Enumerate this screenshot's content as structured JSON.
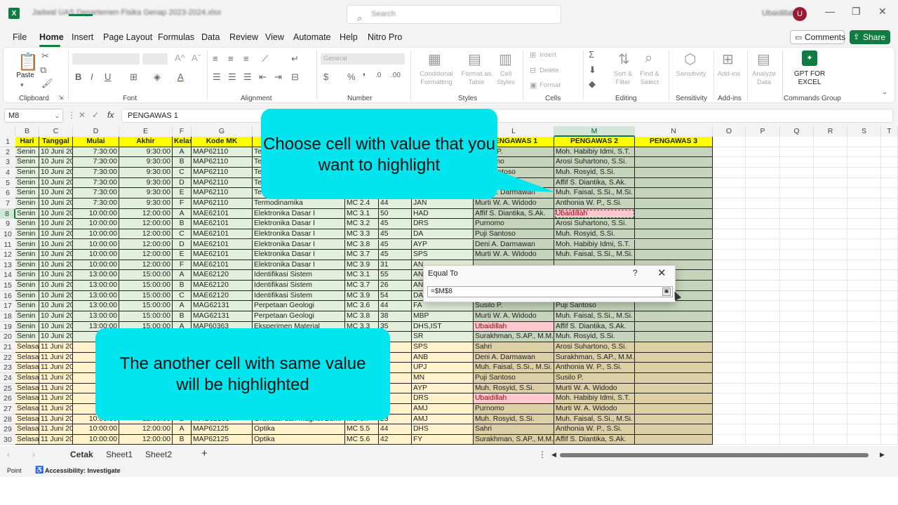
{
  "titlebar": {
    "app_icon": "X",
    "doc_title": "Jadwal UAS Departemen Fisika Genap 2023-2024.xlsx",
    "search_placeholder": "Search",
    "user_name": "Ubaidillah",
    "avatar_initial": "U",
    "minimize": "—",
    "restore": "❐",
    "close": "✕"
  },
  "menu": {
    "items": [
      "File",
      "Home",
      "Insert",
      "Page Layout",
      "Formulas",
      "Data",
      "Review",
      "View",
      "Automate",
      "Help",
      "Nitro Pro"
    ],
    "active": "Home",
    "comments_label": "Comments",
    "share_label": "Share"
  },
  "ribbon": {
    "groups": [
      "Clipboard",
      "Font",
      "Alignment",
      "Number",
      "Styles",
      "Cells",
      "Editing",
      "Sensitivity",
      "Add-ins",
      "Commands Group"
    ],
    "paste_label": "Paste",
    "number_format": "General",
    "styles_buttons": [
      "Conditional Formatting",
      "Format as Table",
      "Cell Styles"
    ],
    "cells_buttons": [
      "Insert",
      "Delete",
      "Format"
    ],
    "editing_buttons": [
      "Sort & Filter",
      "Find & Select"
    ],
    "sensitivity_label": "Sensitivity",
    "addins_label": "Add-ins",
    "analyze_label": "Analyze Data",
    "gpt_label": "GPT FOR EXCEL"
  },
  "formula_bar": {
    "name_box": "M8",
    "cancel_symbol": "✕",
    "enter_symbol": "✓",
    "fx_symbol": "fx",
    "content": "PENGAWAS 1"
  },
  "columns": [
    "B",
    "C",
    "D",
    "E",
    "F",
    "G",
    "H",
    "I",
    "J",
    "K",
    "L",
    "M",
    "N",
    "O",
    "P",
    "Q",
    "R",
    "S",
    "T"
  ],
  "selected_column": "M",
  "selected_row": "8",
  "headers": [
    "Hari",
    "Tanggal",
    "Mulai",
    "Akhir",
    "Kelas",
    "Kode MK",
    "",
    "",
    "",
    "",
    "PENGAWAS 1",
    "PENGAWAS 2",
    "PENGAWAS 3"
  ],
  "rows": [
    {
      "n": "2",
      "day": "Senin",
      "date": "10 Juni 2024",
      "start": "7:30:00",
      "end": "9:30:00",
      "cls": "A",
      "code": "MAP62110",
      "course": "Te",
      "room": "",
      "cap": "",
      "lec": "",
      "p1": "Susilo P.",
      "p2": "Moh. Habibiy Idmi, S.T.",
      "p1_hl": false,
      "p2_hl": false
    },
    {
      "n": "3",
      "day": "Senin",
      "date": "10 Juni 2024",
      "start": "7:30:00",
      "end": "9:30:00",
      "cls": "B",
      "code": "MAP62110",
      "course": "Te",
      "room": "",
      "cap": "",
      "lec": "",
      "p1": "Purnomo",
      "p2": "Arosi Suhartono, S.Si.",
      "p1_hl": false,
      "p2_hl": false
    },
    {
      "n": "4",
      "day": "Senin",
      "date": "10 Juni 2024",
      "start": "7:30:00",
      "end": "9:30:00",
      "cls": "C",
      "code": "MAP62110",
      "course": "Te",
      "room": "",
      "cap": "",
      "lec": "",
      "p1": "Puji Santoso",
      "p2": "Muh. Rosyid, S.Si.",
      "p1_hl": false,
      "p2_hl": false
    },
    {
      "n": "5",
      "day": "Senin",
      "date": "10 Juni 2024",
      "start": "7:30:00",
      "end": "9:30:00",
      "cls": "D",
      "code": "MAP62110",
      "course": "Te",
      "room": "",
      "cap": "",
      "lec": "",
      "p1": "",
      "p2": "Affif S. Diantika, S.Ak.",
      "p1_hl": false,
      "p2_hl": false
    },
    {
      "n": "6",
      "day": "Senin",
      "date": "10 Juni 2024",
      "start": "7:30:00",
      "end": "9:30:00",
      "cls": "E",
      "code": "MAP62110",
      "course": "Te",
      "room": "",
      "cap": "",
      "lec": "",
      "p1": "Deni A. Darmawan",
      "p2": "Muh. Faisal, S.Si., M.Si.",
      "p1_hl": false,
      "p2_hl": false
    },
    {
      "n": "7",
      "day": "Senin",
      "date": "10 Juni 2024",
      "start": "7:30:00",
      "end": "9:30:00",
      "cls": "F",
      "code": "MAP62110",
      "course": "Termodinamika",
      "room": "MC 2.4",
      "cap": "44",
      "lec": "JAN",
      "p1": "Murti W. A. Widodo",
      "p2": "Anthonia W. P., S.Si.",
      "p1_hl": false,
      "p2_hl": false
    },
    {
      "n": "8",
      "day": "Senin",
      "date": "10 Juni 2024",
      "start": "10:00:00",
      "end": "12:00:00",
      "cls": "A",
      "code": "MAE62101",
      "course": "Elektronika Dasar I",
      "room": "MC 3.1",
      "cap": "50",
      "lec": "HAD",
      "p1": "Affif S. Diantika, S.Ak.",
      "p2": "Ubaidillah",
      "p1_hl": false,
      "p2_hl": true
    },
    {
      "n": "9",
      "day": "Senin",
      "date": "10 Juni 2024",
      "start": "10:00:00",
      "end": "12:00:00",
      "cls": "B",
      "code": "MAE62101",
      "course": "Elektronika Dasar I",
      "room": "MC 3.2",
      "cap": "45",
      "lec": "DRS",
      "p1": "Purnomo",
      "p2": "Arosi Suhartono, S.Si.",
      "p1_hl": false,
      "p2_hl": false
    },
    {
      "n": "10",
      "day": "Senin",
      "date": "10 Juni 2024",
      "start": "10:00:00",
      "end": "12:00:00",
      "cls": "C",
      "code": "MAE62101",
      "course": "Elektronika Dasar I",
      "room": "MC 3.3",
      "cap": "45",
      "lec": "DA",
      "p1": "Puji Santoso",
      "p2": "Muh. Rosyid, S.Si.",
      "p1_hl": false,
      "p2_hl": false
    },
    {
      "n": "11",
      "day": "Senin",
      "date": "10 Juni 2024",
      "start": "10:00:00",
      "end": "12:00:00",
      "cls": "D",
      "code": "MAE62101",
      "course": "Elektronika Dasar I",
      "room": "MC 3.8",
      "cap": "45",
      "lec": "AYP",
      "p1": "Deni A. Darmawan",
      "p2": "Moh. Habibiy Idmi, S.T.",
      "p1_hl": false,
      "p2_hl": false
    },
    {
      "n": "12",
      "day": "Senin",
      "date": "10 Juni 2024",
      "start": "10:00:00",
      "end": "12:00:00",
      "cls": "E",
      "code": "MAE62101",
      "course": "Elektronika Dasar I",
      "room": "MC 3.7",
      "cap": "45",
      "lec": "SPS",
      "p1": "Murti W. A. Widodo",
      "p2": "Muh. Faisal, S.Si., M.Si.",
      "p1_hl": false,
      "p2_hl": false
    },
    {
      "n": "13",
      "day": "Senin",
      "date": "10 Juni 2024",
      "start": "10:00:00",
      "end": "12:00:00",
      "cls": "F",
      "code": "MAE62101",
      "course": "Elektronika Dasar I",
      "room": "MC 3.9",
      "cap": "31",
      "lec": "AN",
      "p1": "",
      "p2": "",
      "p1_hl": false,
      "p2_hl": false
    },
    {
      "n": "14",
      "day": "Senin",
      "date": "10 Juni 2024",
      "start": "13:00:00",
      "end": "15:00:00",
      "cls": "A",
      "code": "MAE62120",
      "course": "Identifikasi Sistem",
      "room": "MC 3.1",
      "cap": "55",
      "lec": "AN",
      "p1": "",
      "p2": "",
      "p1_hl": false,
      "p2_hl": false
    },
    {
      "n": "15",
      "day": "Senin",
      "date": "10 Juni 2024",
      "start": "13:00:00",
      "end": "15:00:00",
      "cls": "B",
      "code": "MAE62120",
      "course": "Identifikasi Sistem",
      "room": "MC 3.7",
      "cap": "26",
      "lec": "AN",
      "p1": "",
      "p2": "",
      "p1_hl": false,
      "p2_hl": false
    },
    {
      "n": "16",
      "day": "Senin",
      "date": "10 Juni 2024",
      "start": "13:00:00",
      "end": "15:00:00",
      "cls": "C",
      "code": "MAE62120",
      "course": "Identifikasi Sistem",
      "room": "MC 3.9",
      "cap": "54",
      "lec": "DA",
      "p1": "",
      "p2": "",
      "p1_hl": false,
      "p2_hl": false
    },
    {
      "n": "17",
      "day": "Senin",
      "date": "10 Juni 2024",
      "start": "13:00:00",
      "end": "15:00:00",
      "cls": "A",
      "code": "MAG62131",
      "course": "Perpetaan Geologi",
      "room": "MC 3.6",
      "cap": "44",
      "lec": "FA",
      "p1": "Susilo P.",
      "p2": "Puji Santoso",
      "p1_hl": false,
      "p2_hl": false
    },
    {
      "n": "18",
      "day": "Senin",
      "date": "10 Juni 2024",
      "start": "13:00:00",
      "end": "15:00:00",
      "cls": "B",
      "code": "MAG62131",
      "course": "Perpetaan Geologi",
      "room": "MC 3.8",
      "cap": "38",
      "lec": "MBP",
      "p1": "Murti W. A. Widodo",
      "p2": "Muh. Faisal, S.Si., M.Si.",
      "p1_hl": false,
      "p2_hl": false
    },
    {
      "n": "19",
      "day": "Senin",
      "date": "10 Juni 2024",
      "start": "13:00:00",
      "end": "15:00:00",
      "cls": "A",
      "code": "MAP60363",
      "course": "Eksperimen Material",
      "room": "MC 3.3",
      "cap": "35",
      "lec": "DHS,IST",
      "p1": "Ubaidillah",
      "p2": "Affif S. Diantika, S.Ak.",
      "p1_hl": true,
      "p2_hl": false
    },
    {
      "n": "20",
      "day": "Senin",
      "date": "10 Juni 2024",
      "start": "",
      "end": "",
      "cls": "",
      "code": "",
      "course": "",
      "room": "",
      "cap": "24",
      "lec": "SR",
      "p1": "Surakhman, S.AP., M.M.",
      "p2": "Muh. Rosyid, S.Si.",
      "p1_hl": false,
      "p2_hl": false
    },
    {
      "n": "21",
      "day": "Selasa",
      "date": "11 Juni 2024",
      "start": "",
      "end": "",
      "cls": "",
      "code": "",
      "course": "",
      "room": "",
      "cap": "37",
      "lec": "SPS",
      "p1": "Sahri",
      "p2": "Arosi Suhartono, S.Si.",
      "p1_hl": false,
      "p2_hl": false
    },
    {
      "n": "22",
      "day": "Selasa",
      "date": "11 Juni 2024",
      "start": "",
      "end": "",
      "cls": "",
      "code": "",
      "course": "",
      "room": "",
      "cap": "46",
      "lec": "ANB",
      "p1": "Deni A. Darmawan",
      "p2": "Surakhman, S.AP., M.M.",
      "p1_hl": false,
      "p2_hl": false
    },
    {
      "n": "23",
      "day": "Selasa",
      "date": "11 Juni 2024",
      "start": "",
      "end": "",
      "cls": "",
      "code": "",
      "course": "",
      "room": "",
      "cap": "45",
      "lec": "UPJ",
      "p1": "Muh. Faisal, S.Si., M.Si.",
      "p2": "Anthonia W. P., S.Si.",
      "p1_hl": false,
      "p2_hl": false
    },
    {
      "n": "24",
      "day": "Selasa",
      "date": "11 Juni 2024",
      "start": "",
      "end": "",
      "cls": "",
      "code": "",
      "course": "",
      "room": "",
      "cap": "45",
      "lec": "MN",
      "p1": "Puji Santoso",
      "p2": "Susilo P.",
      "p1_hl": false,
      "p2_hl": false
    },
    {
      "n": "25",
      "day": "Selasa",
      "date": "11 Juni 2024",
      "start": "",
      "end": "",
      "cls": "",
      "code": "",
      "course": "",
      "room": "",
      "cap": "44",
      "lec": "AYP",
      "p1": "Muh. Rosyid, S.Si.",
      "p2": "Murti W. A. Widodo",
      "p1_hl": false,
      "p2_hl": false
    },
    {
      "n": "26",
      "day": "Selasa",
      "date": "11 Juni 2024",
      "start": "",
      "end": "",
      "cls": "",
      "code": "",
      "course": "",
      "room": "",
      "cap": "43",
      "lec": "DRS",
      "p1": "Ubaidillah",
      "p2": "Moh. Habibiy Idmi, S.T.",
      "p1_hl": true,
      "p2_hl": false
    },
    {
      "n": "27",
      "day": "Selasa",
      "date": "11 Juni 2024",
      "start": "",
      "end": "",
      "cls": "",
      "code": "",
      "course": "",
      "room": "",
      "cap": "42",
      "lec": "AMJ",
      "p1": "Purnomo",
      "p2": "Murti W. A. Widodo",
      "p1_hl": false,
      "p2_hl": false
    },
    {
      "n": "28",
      "day": "Selasa",
      "date": "11 Juni 2024",
      "start": "10:00:00",
      "end": "12:00:00",
      "cls": "B",
      "code": "MAG62103",
      "course": "Gravitasi dan Magnet Bumi",
      "room": "MC 6.7",
      "cap": "23",
      "lec": "AMJ",
      "p1": "Muh. Rosyid, S.Si.",
      "p2": "Muh. Faisal, S.Si., M.Si.",
      "p1_hl": false,
      "p2_hl": false
    },
    {
      "n": "29",
      "day": "Selasa",
      "date": "11 Juni 2024",
      "start": "10:00:00",
      "end": "12:00:00",
      "cls": "A",
      "code": "MAP62125",
      "course": "Optika",
      "room": "MC 5.5",
      "cap": "44",
      "lec": "DHS",
      "p1": "Sahri",
      "p2": "Anthonia W. P., S.Si.",
      "p1_hl": false,
      "p2_hl": false
    },
    {
      "n": "30",
      "day": "Selasa",
      "date": "11 Juni 2024",
      "start": "10:00:00",
      "end": "12:00:00",
      "cls": "B",
      "code": "MAP62125",
      "course": "Optika",
      "room": "MC 5.6",
      "cap": "42",
      "lec": "FY",
      "p1": "Surakhman, S.AP., M.M.",
      "p2": "Affif S. Diantika, S.Ak.",
      "p1_hl": false,
      "p2_hl": false
    }
  ],
  "callouts": {
    "top": "Choose cell with value that you want to highlight",
    "bottom": "The another cell with same value will be highlighted"
  },
  "dialog": {
    "title": "Equal To",
    "help": "?",
    "close": "✕",
    "input_value": "=$M$8"
  },
  "sheet_tabs": [
    "Cetak",
    "Sheet1",
    "Sheet2"
  ],
  "active_sheet": "Cetak",
  "add_sheet": "+",
  "status": {
    "mode": "Point",
    "accessibility": "Accessibility: Investigate"
  },
  "colors": {
    "excel_green": "#107c41",
    "header_yellow": "#ffff00",
    "senin_fill": "#e2efda",
    "selasa_fill": "#fff2cc",
    "highlight_fill": "#ffc7ce",
    "highlight_text": "#9c0006",
    "callout": "#00e5ee"
  }
}
